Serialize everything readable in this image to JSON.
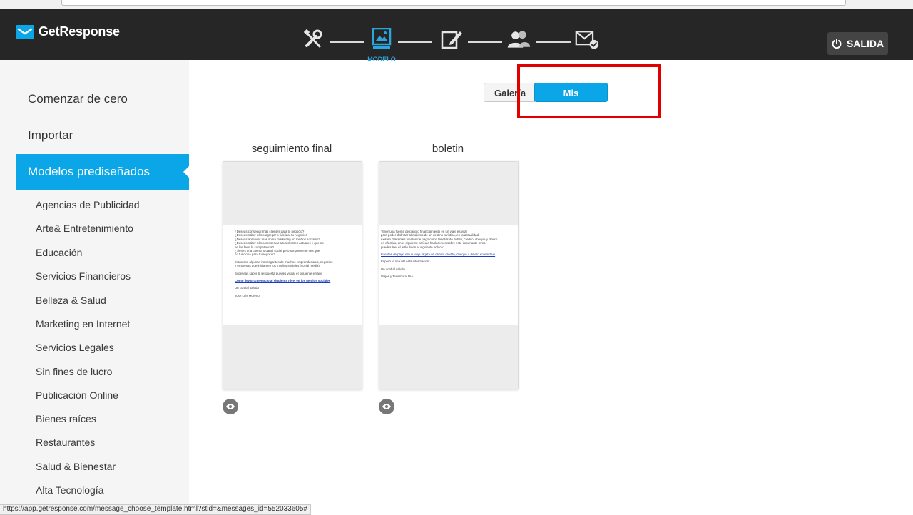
{
  "brand": {
    "name": "GetResponse",
    "color": "#0aa6e8"
  },
  "steps": {
    "items": [
      {
        "icon": "tools-icon",
        "label": ""
      },
      {
        "icon": "template-icon",
        "label": "MODELO",
        "active": true
      },
      {
        "icon": "edit-icon",
        "label": ""
      },
      {
        "icon": "contacts-icon",
        "label": ""
      },
      {
        "icon": "send-check-icon",
        "label": ""
      }
    ]
  },
  "header": {
    "exit_label": "SALIDA"
  },
  "sidebar": {
    "main": [
      {
        "label": "Comenzar de cero"
      },
      {
        "label": "Importar"
      },
      {
        "label": "Modelos prediseñados",
        "active": true
      }
    ],
    "categories": [
      "Agencias de Publicidad",
      "Arte& Entretenimiento",
      "Educación",
      "Servicios Financieros",
      "Belleza & Salud",
      "Marketing en Internet",
      "Servicios Legales",
      "Sin fines de lucro",
      "Publicación Online",
      "Bienes raíces",
      "Restaurantes",
      "Salud & Bienestar",
      "Alta Tecnología"
    ]
  },
  "toggle": {
    "gallery_label": "Galería",
    "mine_label": "Mis modelos",
    "active": "mine"
  },
  "templates": [
    {
      "title": "seguimiento final",
      "preview": [
        "¿Deseas conseguir más clientes para tu negocio?",
        "¿Deseas saber cómo agregar o fidelizar tu negocio?",
        "¿Deseas aprender más sobre marketing en medios sociales?",
        "¿Deseas saber cómo conservar a tus clientes actuales y que no",
        "se los lleve la competencia?",
        "¿Tienes una cuenta o canal social pero simplemente ves que",
        "no funciona para tu negocio?",
        "",
        "Estas son algunas interrogantes de muchos emprendedores, negocios",
        "y empresas que inician en los medios sociales (social media).",
        "",
        "Si deseas saber la respuesta puedes visitar el siguiente enlace",
        "",
        "Como llevar tu negocio al siguiente nivel en los medios sociales",
        "",
        "Un cordial saludo",
        "",
        "Jose Luis Moreno"
      ]
    },
    {
      "title": "boletin",
      "preview": [
        "Tener una fuente de pago o financiamiento en un viaje es vital",
        "para poder disfrutar al máximo de un destino turístico, en la actualidad",
        "existen diferentes fuentes de pago como tarjetas de débito, crédito, cheque y dinero",
        "en efectivo, en el siguiente artículo hablaremos sobre este importante tema",
        "puedes leer el artículo en el siguiente enlace:",
        "",
        "Fuentes de pago en un viaje tarjeta de débito, crédito, cheque o dinero en efectivo",
        "",
        "Espero te sea útil esta información",
        "",
        "Un cordial saludo",
        "",
        "Viajes y Turismo al Día"
      ]
    }
  ],
  "status_url": "https://app.getresponse.com/message_choose_template.html?stid=&messages_id=552033605#"
}
